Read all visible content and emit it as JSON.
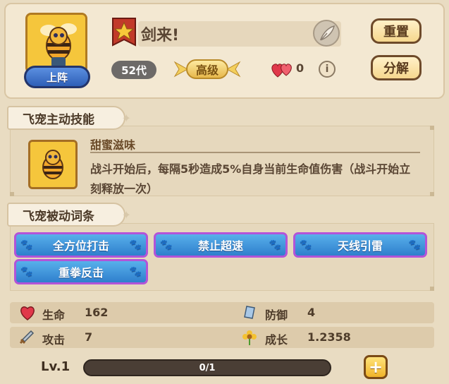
{
  "header": {
    "deploy_label": "上阵",
    "pet_name": "剑来!",
    "reset_label": "重置",
    "decompose_label": "分解",
    "generation": "52代",
    "grade": "高级",
    "heart_count": "0",
    "info_label": "i"
  },
  "active_skill": {
    "section_title": "飞宠主动技能",
    "name": "甜蜜滋味",
    "description": "战斗开始后，每隔5秒造成5%自身当前生命值伤害（战斗开始立刻释放一次）"
  },
  "passive_traits": {
    "section_title": "飞宠被动词条",
    "tags": [
      "全方位打击",
      "禁止超速",
      "天线引雷",
      "重拳反击"
    ]
  },
  "stats": {
    "hp_label": "生命",
    "hp_value": "162",
    "def_label": "防御",
    "def_value": "4",
    "atk_label": "攻击",
    "atk_value": "7",
    "growth_label": "成长",
    "growth_value": "1.2358"
  },
  "level": {
    "label": "Lv.1",
    "exp_text": "0/1",
    "exp_fraction": 0,
    "plus_label": "+"
  },
  "colors": {
    "background": "#e9dcc2",
    "deploy_button": "#2e5fb7",
    "tag_fill": "#2f7fcd",
    "tag_border": "#b254d8"
  }
}
